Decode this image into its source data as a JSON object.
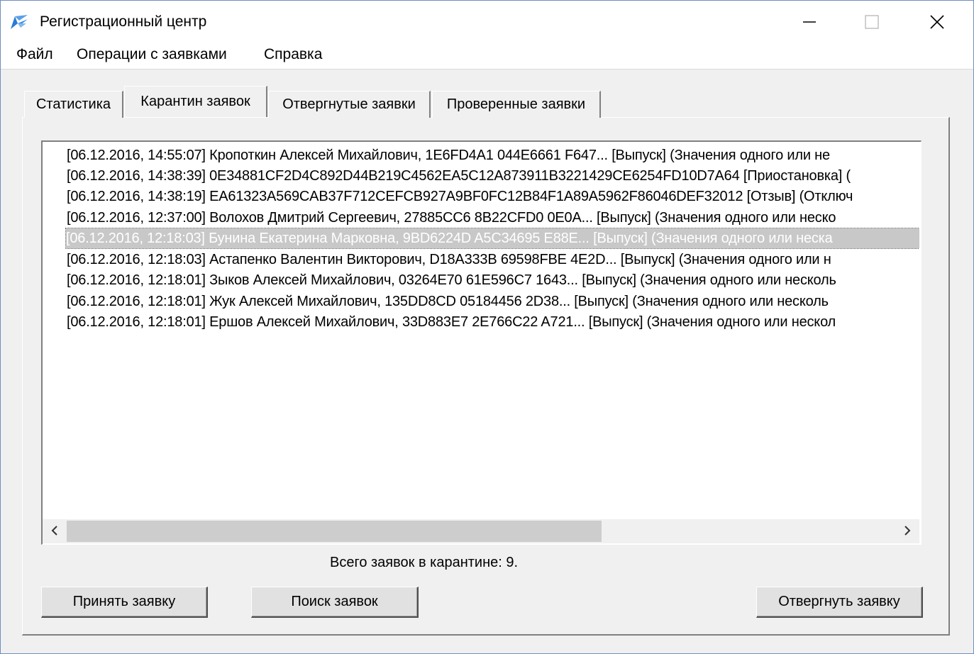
{
  "window": {
    "title": "Регистрационный центр",
    "controls": {
      "minimize_icon": "minimize-icon",
      "maximize_icon": "maximize-icon",
      "close_icon": "close-icon"
    }
  },
  "menu": {
    "items": [
      "Файл",
      "Операции с заявками",
      "Справка"
    ]
  },
  "tabs": {
    "items": [
      "Статистика",
      "Карантин заявок",
      "Отвергнутые заявки",
      "Проверенные заявки"
    ],
    "active": "Карантин заявок"
  },
  "quarantine": {
    "rows": [
      "[06.12.2016, 14:55:07] Кропоткин Алексей Михайлович, 1E6FD4A1 044E6661 F647... [Выпуск] (Значения одного или не",
      "[06.12.2016, 14:38:39] 0E34881CF2D4C892D44B219C4562EA5C12A873911B3221429CE6254FD10D7A64 [Приостановка] (",
      "[06.12.2016, 14:38:19] EA61323A569CAB37F712CEFCB927A9BF0FC12B84F1A89A5962F86046DEF32012 [Отзыв] (Отключ",
      "[06.12.2016, 12:37:00] Волохов Дмитрий Сергеевич, 27885CC6 8B22CFD0 0E0A... [Выпуск] (Значения одного или неско",
      "[06.12.2016, 12:18:03] Бунина Екатерина Марковна, 9BD6224D A5C34695 E88E... [Выпуск] (Значения одного или неска",
      "[06.12.2016, 12:18:03] Астапенко Валентин Викторович, D18A333B 69598FBE 4E2D... [Выпуск] (Значения одного или н",
      "[06.12.2016, 12:18:01] Зыков Алексей Михайлович, 03264E70 61E596C7 1643... [Выпуск] (Значения одного или несколь",
      "[06.12.2016, 12:18:01] Жук Алексей Михайлович, 135DD8CD 05184456 2D38... [Выпуск] (Значения одного или несколь",
      "[06.12.2016, 12:18:01] Ершов Алексей Михайлович, 33D883E7 2E766C22 A721... [Выпуск] (Значения одного или нескол"
    ],
    "selected_index": 4,
    "status": "Всего заявок в карантине: 9.",
    "scrollbar": {
      "left_icon": "scroll-left-icon",
      "right_icon": "scroll-right-icon"
    }
  },
  "buttons": {
    "accept": "Принять заявку",
    "search": "Поиск заявок",
    "reject": "Отвергнуть заявку"
  },
  "colors": {
    "selection": "#c8c8c8",
    "window_border": "#6e8fbf",
    "background": "#f0f0f0"
  }
}
